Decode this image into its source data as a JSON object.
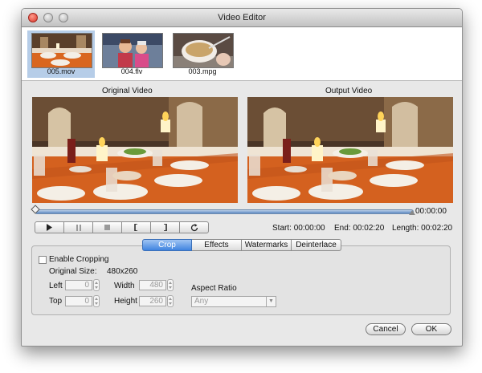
{
  "window": {
    "title": "Video Editor"
  },
  "files": [
    {
      "name": "005.mov",
      "selected": true
    },
    {
      "name": "004.flv",
      "selected": false
    },
    {
      "name": "003.mpg",
      "selected": false
    }
  ],
  "preview": {
    "original_label": "Original Video",
    "output_label": "Output Video"
  },
  "timeline": {
    "current_time": "00:00:00",
    "progress": 0
  },
  "controls": {
    "play_icon": "play-icon",
    "pause_icon": "pause-icon",
    "stop_icon": "stop-icon",
    "mark_in_icon": "mark-in-bracket",
    "mark_out_icon": "mark-out-bracket",
    "loop_icon": "loop-icon",
    "start_label": "Start:",
    "start_value": "00:00:00",
    "end_label": "End:",
    "end_value": "00:02:20",
    "length_label": "Length:",
    "length_value": "00:02:20"
  },
  "tabs": [
    {
      "label": "Crop",
      "active": true
    },
    {
      "label": "Effects",
      "active": false
    },
    {
      "label": "Watermarks",
      "active": false
    },
    {
      "label": "Deinterlace",
      "active": false
    }
  ],
  "crop": {
    "enable_label": "Enable Cropping",
    "enabled": false,
    "original_size_label": "Original Size:",
    "original_size_value": "480x260",
    "left_label": "Left",
    "left_value": "0",
    "top_label": "Top",
    "top_value": "0",
    "width_label": "Width",
    "width_value": "480",
    "height_label": "Height",
    "height_value": "260",
    "aspect_ratio_label": "Aspect Ratio",
    "aspect_ratio_value": "Any"
  },
  "buttons": {
    "cancel": "Cancel",
    "ok": "OK"
  },
  "colors": {
    "accent": "#3f84e0",
    "selection": "#b6cde8",
    "timeline": "#5b87c2"
  }
}
